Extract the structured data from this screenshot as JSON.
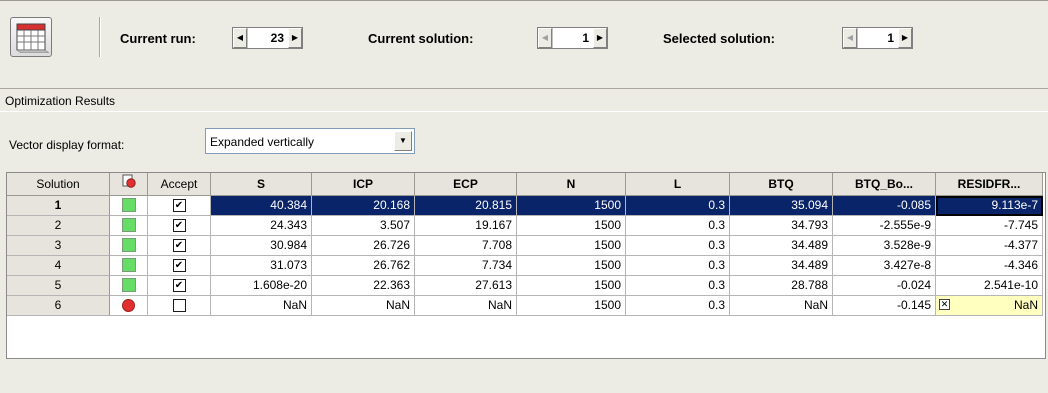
{
  "toolbar": {
    "icon": "table-view-icon",
    "current_run_label": "Current run:",
    "current_run_value": "23",
    "current_solution_label": "Current solution:",
    "current_solution_value": "1",
    "selected_solution_label": "Selected solution:",
    "selected_solution_value": "1"
  },
  "panel": {
    "title": "Optimization Results",
    "vector_format_label": "Vector display format:",
    "vector_format_value": "Expanded vertically"
  },
  "colors": {
    "selection": "#0a246a",
    "ok_status": "#66dd66",
    "error_status": "#e03030",
    "error_cell": "#ffffc0"
  },
  "table": {
    "columns": [
      "Solution",
      "status-icon",
      "Accept",
      "S",
      "ICP",
      "ECP",
      "N",
      "L",
      "BTQ",
      "BTQ_Bo...",
      "RESIDFR..."
    ],
    "rows": [
      {
        "solution": "1",
        "status": "ok",
        "accept": true,
        "S": "40.384",
        "ICP": "20.168",
        "ECP": "20.815",
        "N": "1500",
        "L": "0.3",
        "BTQ": "35.094",
        "BTQ_Bo": "-0.085",
        "RESIDFR": "9.113e-7"
      },
      {
        "solution": "2",
        "status": "ok",
        "accept": true,
        "S": "24.343",
        "ICP": "3.507",
        "ECP": "19.167",
        "N": "1500",
        "L": "0.3",
        "BTQ": "34.793",
        "BTQ_Bo": "-2.555e-9",
        "RESIDFR": "-7.745"
      },
      {
        "solution": "3",
        "status": "ok",
        "accept": true,
        "S": "30.984",
        "ICP": "26.726",
        "ECP": "7.708",
        "N": "1500",
        "L": "0.3",
        "BTQ": "34.489",
        "BTQ_Bo": "3.528e-9",
        "RESIDFR": "-4.377"
      },
      {
        "solution": "4",
        "status": "ok",
        "accept": true,
        "S": "31.073",
        "ICP": "26.762",
        "ECP": "7.734",
        "N": "1500",
        "L": "0.3",
        "BTQ": "34.489",
        "BTQ_Bo": "3.427e-8",
        "RESIDFR": "-4.346"
      },
      {
        "solution": "5",
        "status": "ok",
        "accept": true,
        "S": "1.608e-20",
        "ICP": "22.363",
        "ECP": "27.613",
        "N": "1500",
        "L": "0.3",
        "BTQ": "28.788",
        "BTQ_Bo": "-0.024",
        "RESIDFR": "2.541e-10"
      },
      {
        "solution": "6",
        "status": "error",
        "accept": false,
        "S": "NaN",
        "ICP": "NaN",
        "ECP": "NaN",
        "N": "1500",
        "L": "0.3",
        "BTQ": "NaN",
        "BTQ_Bo": "-0.145",
        "RESIDFR": "NaN"
      }
    ]
  }
}
